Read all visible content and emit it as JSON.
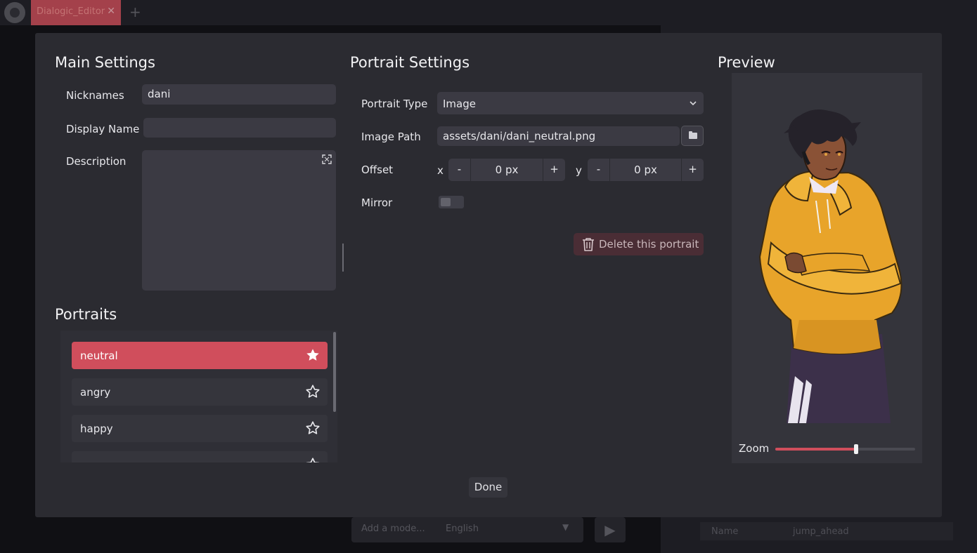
{
  "background": {
    "tab_label": "Dialogic_Editor",
    "tab_close": "✕",
    "add_tab": "+",
    "bottom_mode": "Add a mode...",
    "bottom_language": "English",
    "bottom_arrow": "▼",
    "play": "▶",
    "name_label": "Name",
    "name_value": "jump_ahead"
  },
  "main_settings": {
    "title": "Main Settings",
    "nicknames_label": "Nicknames",
    "nicknames_value": "dani",
    "display_name_label": "Display Name",
    "display_name_value": "",
    "description_label": "Description",
    "description_value": ""
  },
  "portraits": {
    "title": "Portraits",
    "items": [
      {
        "label": "neutral",
        "selected": true,
        "default": true
      },
      {
        "label": "angry",
        "selected": false,
        "default": false
      },
      {
        "label": "happy",
        "selected": false,
        "default": false
      }
    ]
  },
  "portrait_settings": {
    "title": "Portrait Settings",
    "type_label": "Portrait Type",
    "type_value": "Image",
    "path_label": "Image Path",
    "path_value": "assets/dani/dani_neutral.png",
    "offset_label": "Offset",
    "x_label": "x",
    "x_value": "0 px",
    "y_label": "y",
    "y_value": "0 px",
    "minus": "-",
    "plus": "+",
    "mirror_label": "Mirror",
    "mirror_on": false,
    "delete_label": "Delete this portrait"
  },
  "preview": {
    "title": "Preview",
    "zoom_label": "Zoom",
    "zoom_fraction": 0.58
  },
  "done_label": "Done",
  "colors": {
    "accent": "#d04e5c",
    "modal_bg": "#2b2b31",
    "field_bg": "#3b3a43"
  }
}
